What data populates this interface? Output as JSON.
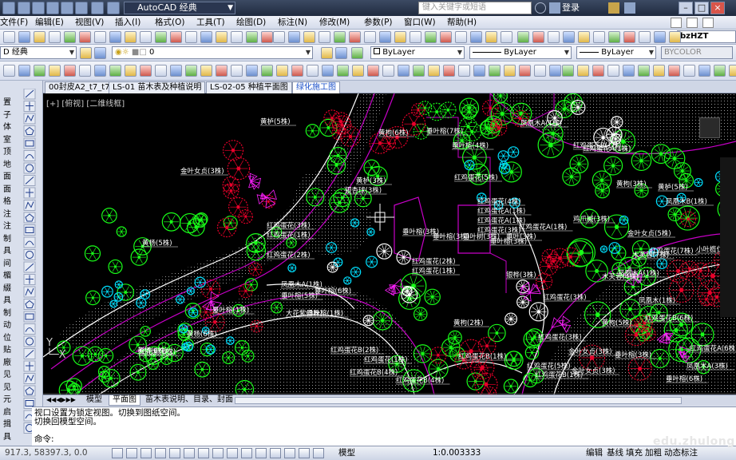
{
  "titlebar": {
    "app_title": "AutoCAD 经典",
    "search_placeholder": "键入关键字或短语",
    "login_label": "登录"
  },
  "menubar": {
    "items": [
      "文件(F)",
      "编辑(E)",
      "视图(V)",
      "插入(I)",
      "格式(O)",
      "工具(T)",
      "绘图(D)",
      "标注(N)",
      "修改(M)",
      "参数(P)",
      "窗口(W)",
      "帮助(H)"
    ]
  },
  "toolbar": {
    "workspace": "D 经典",
    "layer_value": "0",
    "color": "ByLayer",
    "linetype": "ByLayer",
    "lineweight": "ByLayer",
    "plotstyle": "BYCOLOR",
    "text_style": "bzHZT"
  },
  "left_panel": {
    "labels": [
      "置",
      "子",
      "体",
      "室",
      "顶",
      "地",
      "面",
      "面",
      "格",
      "注",
      "注",
      "制",
      "具",
      "间",
      "楣",
      "綴",
      "具",
      "制",
      "动",
      "位",
      "贴",
      "廠",
      "见",
      "见",
      "元",
      "启",
      "揖",
      "具"
    ]
  },
  "file_tabs": [
    "00封皮A2_t7_t7",
    "LS-01 苗木表及种植说明",
    "LS-02-05 种植平面图",
    "绿化施工图"
  ],
  "viewport_label": "[+] [俯视] [二维线框]",
  "drawing_labels": [
    "黄栌(5株)",
    "金叶女贞(3株)",
    "黄杨(5株)",
    "红鸡蛋花(3株)",
    "红鸡蛋花(1株)",
    "红鸡蛋花(2株)",
    "黄栌(3株)",
    "银杏球(3株)",
    "垂叶榕(3株)",
    "垂叶榕(3株)",
    "垂叶树(3株)",
    "垂叶(3株)",
    "红鸡蛋花(2株)",
    "红鸡蛋花(1株)",
    "凤凰木A(1株)",
    "垂叶榕(6株)",
    "垂叶榕(5株)",
    "垂叶榕(1株)",
    "大花紫(3株)",
    "黄杨(6株)",
    "黄杨(6株)",
    "垂叶榕(3株)",
    "凤凰木A(1株)",
    "红鸡蛋花(4株)",
    "红鸡蛋花A(1株)",
    "红鸡蛋花A(1株)",
    "红鸡蛋花(3株)",
    "红鸡蛋花(5株)",
    "垂叶榕(7株)",
    "黄枸(6株)",
    "垂叶榕(4株)",
    "红鸡蛋花B(1株)",
    "红鸡蛋花A(1株)",
    "红鸡蛋花B(1株)",
    "凤凰木A(1株)",
    "红鸡蛋花(2株)",
    "红鸡蛋花(1株)",
    "凤凰木B(1株)",
    "小叶榄仁(3株)",
    "凤凰木(1株)",
    "红鸡蛋花(3株)",
    "黄枸(2株)",
    "木芙蓉(7株)",
    "木芙蓉(4株)",
    "凤凰木A(1株)",
    "红鸡蛋花(3株)",
    "黄枸(5株)",
    "红鸡蛋花A(1株)",
    "银桦(3株)",
    "红鸡蛋花B(2株)",
    "红鸡蛋花B(4株)",
    "金叶女贞(3株)",
    "红鸡蛋花(1株)",
    "红鸡蛋花B(1株)",
    "红鸡蛋花B(4株)",
    "凤凰木A(3株)",
    "红鸡蛋花B(1株)",
    "鸡爪槭(3株)",
    "黄栌(5株)",
    "金叶女贞(5株)",
    "黄栌(5株)",
    "垂叶榕(6株)",
    "红鸡蛋花B(6株)",
    "垂叶榕(3株)",
    "金叶女贞(3株)",
    "红鸡蛋花(5株)",
    "红鸡蛋花A(6株)",
    "红鸡蛋花(7株)",
    "黄枸(3株)",
    "红花紫(8株)",
    "垂叶榕(1株)"
  ],
  "layout_tabs": [
    "模型",
    "平面图",
    "苗木表说明、目录、封面"
  ],
  "command": {
    "history": [
      "视口设置为锁定视图。切换到图纸空间。",
      "切换回模型空间。"
    ],
    "prompt": "命令:"
  },
  "statusbar": {
    "coords": "917.3,    58397.3, 0.0",
    "model_label": "模型",
    "scale": "1:0.003333",
    "buttons": [
      "编辑",
      "基线",
      "填充",
      "加粗",
      "动态标注"
    ]
  },
  "watermark": "edu.zhulong"
}
